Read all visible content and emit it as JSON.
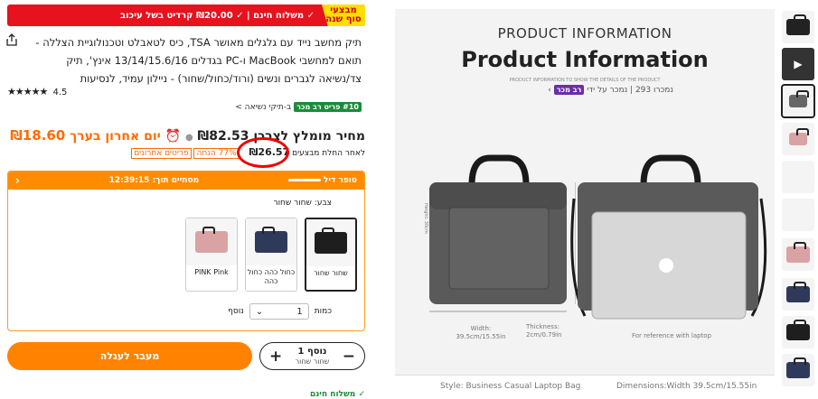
{
  "banner": {
    "promo_label": "מבצעי סוף שנה",
    "shipping_text": "✓ משלוח חינם | ✓ ₪20.00 קרדיט בשל עיכוב"
  },
  "product": {
    "title": "תיק מחשב נייד עם גלגלים מאושר TSA, כיס לטאבלט וטכנולוגיית הצללה - תואם למחשבי MacBook ו-PC בגדלים 13/14/15.6/16 אינץ', תיק צד/נשיאה לגברים ונשים (ורוד/כחול/שחור) - ניילון עמיד, לנסיעות",
    "rating": "4.5",
    "stars": "★★★★★",
    "sold_text": "נמכרו 293 | נמכר על ידי",
    "seller_badge": "רב מכר",
    "rank_badge": "#10 פריט רב מכר",
    "rank_category": "ב-תיקי נשיאה >"
  },
  "price": {
    "recommended_label": "מחיר מומלץ לצרכן",
    "recommended_value": "₪82.53",
    "last_day_label": "יום אחרון",
    "estimate_label": "בערך",
    "estimate_value": "₪18.60",
    "after_coupon_label": "לאחר החלת מבצעים",
    "current_price": "₪26.57",
    "discount_badge": "77% הנחה",
    "last_items_badge": "פריטים אחרונים"
  },
  "deal": {
    "super_deal": "סופר דיל",
    "ends_in": "מסתיים תוך:",
    "timer": "12:39:15",
    "color_label": "צבע: שחור שחור",
    "variants": [
      {
        "label": "שחור שחור",
        "color": "#1e1e1e",
        "selected": true
      },
      {
        "label": "כחול כהה כחול כהה",
        "color": "#2f3a5a",
        "selected": false
      },
      {
        "label": "PINK Pink",
        "color": "#d9a3a3",
        "selected": false
      }
    ],
    "quantity_label": "כמות",
    "quantity_value": "1",
    "quantity_more": "נוסף"
  },
  "cart": {
    "add_label": "מעבר לעגלה",
    "added_count": "1 נוסף",
    "added_variant": "שחור שחור",
    "minus": "−",
    "plus": "+"
  },
  "footer": {
    "shipping_free": "✓ משלוח חינם"
  },
  "image": {
    "heading_small": "PRODUCT INFORMATION",
    "heading_large": "Product Information",
    "sub_caption": "PRODUCT INFORMATION TO SHOW THE DETAILS OF THE PRODUCT",
    "width_caption": "Width: 39.5cm/15.55in",
    "thickness_caption": "Thickness: 2cm/0.79in",
    "height_caption": "Height: 30cm",
    "laptop_caption": "For reference with laptop",
    "style_caption": "Style: Business Casual Laptop Bag",
    "dimensions_caption": "Dimensions:Width 39.5cm/15.55in"
  },
  "colors": {
    "accent_orange": "#ff8200",
    "banner_red": "#e6121d",
    "promo_yellow": "#ffde00"
  }
}
